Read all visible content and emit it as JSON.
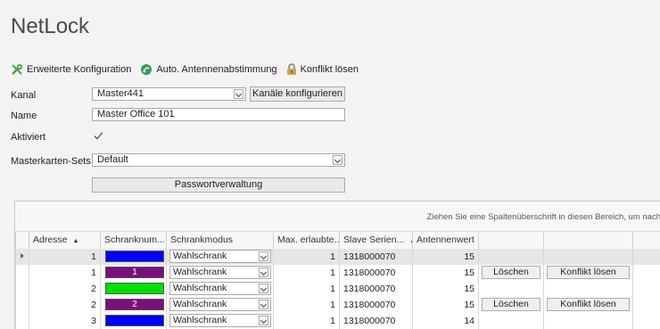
{
  "app": {
    "title": "NetLock"
  },
  "toolbar": {
    "advanced_config": "Erweiterte Konfiguration",
    "auto_tune": "Auto. Antennenabstimmung",
    "resolve_conflict": "Konflikt lösen"
  },
  "form": {
    "kanal_label": "Kanal",
    "kanal_value": "Master441",
    "configure_channels_label": "Kanäle konfigurieren",
    "name_label": "Name",
    "name_value": "Master Office 101",
    "activated_label": "Aktiviert",
    "activated_checked": true,
    "mastercard_label": "Masterkarten-Sets",
    "mastercard_value": "Default",
    "password_button": "Passwortverwaltung"
  },
  "grid": {
    "group_hint": "Ziehen Sie eine Spaltenüberschrift in diesen Bereich, um nach",
    "columns": [
      "Adresse",
      "Schranknum...",
      "Schrankmodus",
      "Max. erlaubte...",
      "Slave Serien...",
      "Antennenwert"
    ],
    "rows": [
      {
        "adresse": "1",
        "color": "#0000ff",
        "num": "",
        "mode": "Wahlschrank",
        "max": "1",
        "serial": "1318000070",
        "antenna": "15",
        "delete": "",
        "conflict": "",
        "selected": true
      },
      {
        "adresse": "1",
        "color": "#7b0f7b",
        "num": "1",
        "mode": "Wahlschrank",
        "max": "1",
        "serial": "1318000070",
        "antenna": "15",
        "delete": "Löschen",
        "conflict": "Konflikt lösen",
        "selected": false
      },
      {
        "adresse": "2",
        "color": "#00e000",
        "num": "",
        "mode": "Wahlschrank",
        "max": "1",
        "serial": "1318000070",
        "antenna": "15",
        "delete": "",
        "conflict": "",
        "selected": false
      },
      {
        "adresse": "2",
        "color": "#7b0f7b",
        "num": "2",
        "mode": "Wahlschrank",
        "max": "1",
        "serial": "1318000070",
        "antenna": "15",
        "delete": "Löschen",
        "conflict": "Konflikt lösen",
        "selected": false
      },
      {
        "adresse": "3",
        "color": "#0000ff",
        "num": "",
        "mode": "Wahlschrank",
        "max": "1",
        "serial": "1318000070",
        "antenna": "14",
        "delete": "",
        "conflict": "",
        "selected": false
      }
    ]
  }
}
